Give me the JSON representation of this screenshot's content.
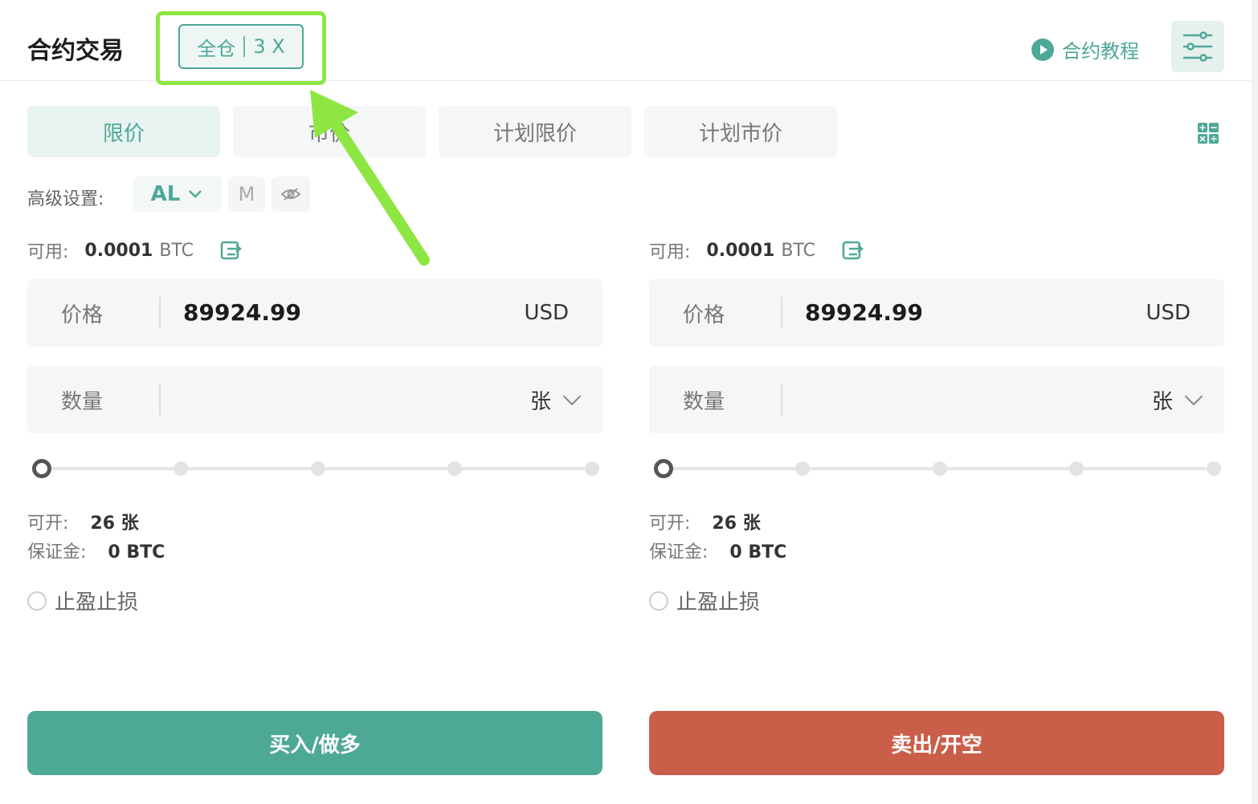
{
  "header": {
    "title": "合约交易",
    "margin_mode": "全仓",
    "leverage": "3 X",
    "tutorial_label": "合约教程"
  },
  "tabs": [
    {
      "label": "限价",
      "active": true
    },
    {
      "label": "市价",
      "active": false
    },
    {
      "label": "计划限价",
      "active": false
    },
    {
      "label": "计划市价",
      "active": false
    }
  ],
  "advanced": {
    "label": "高级设置:",
    "al_label": "AL",
    "m_label": "M"
  },
  "buy": {
    "available_label": "可用:",
    "available_value": "0.0001",
    "available_unit": "BTC",
    "price_label": "价格",
    "price_value": "89924.99",
    "price_unit": "USD",
    "qty_label": "数量",
    "qty_value": "",
    "qty_unit": "张",
    "openable_label": "可开:",
    "openable_value": "26 张",
    "margin_label": "保证金:",
    "margin_value": "0 BTC",
    "tpsl_label": "止盈止损",
    "button_label": "买入/做多"
  },
  "sell": {
    "available_label": "可用:",
    "available_value": "0.0001",
    "available_unit": "BTC",
    "price_label": "价格",
    "price_value": "89924.99",
    "price_unit": "USD",
    "qty_label": "数量",
    "qty_value": "",
    "qty_unit": "张",
    "openable_label": "可开:",
    "openable_value": "26 张",
    "margin_label": "保证金:",
    "margin_value": "0 BTC",
    "tpsl_label": "止盈止损",
    "button_label": "卖出/开空"
  },
  "colors": {
    "accent": "#4da896",
    "buy": "#4da896",
    "sell": "#cb5e48",
    "highlight": "#8ee643"
  },
  "icons": {
    "tutorial": "play-circle-icon",
    "settings": "sliders-icon",
    "calculator": "calculator-icon",
    "hide": "eye-off-icon",
    "transfer": "wallet-transfer-icon"
  }
}
